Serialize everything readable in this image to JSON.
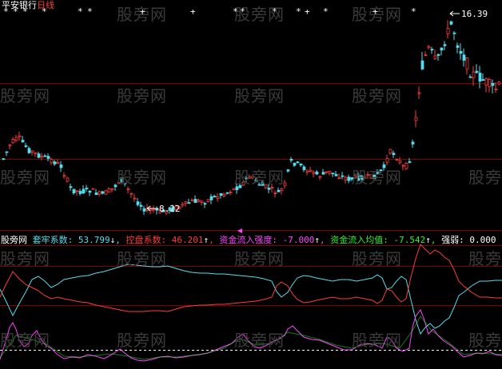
{
  "header": {
    "stock_name": "平安银行",
    "period": "日线"
  },
  "indicator": {
    "name": "股旁网",
    "items": [
      {
        "label": "套牢系数:",
        "value": "53.799",
        "arrow": "↓",
        "color": "#55ddee"
      },
      {
        "label": "控盘系数:",
        "value": "46.201",
        "arrow": "↑",
        "color": "#ff3b3b"
      },
      {
        "label": "资金流入强度:",
        "value": "-7.000",
        "arrow": "↑",
        "color": "#ff44ff"
      },
      {
        "label": "资金流入均值:",
        "value": "-7.542",
        "arrow": "↑",
        "color": "#33ee33"
      },
      {
        "label": "强弱:",
        "value": "0.000",
        "arrow": "",
        "color": "#ffffff"
      }
    ]
  },
  "price_labels": {
    "high": "16.39",
    "low": "8.22"
  },
  "watermark": "股旁网",
  "colors": {
    "up": "#ff3b3b",
    "down": "#55ddee",
    "gridline": "#800000",
    "background": "#000000"
  },
  "signal_marks": {
    "star": "*",
    "plus": "+"
  }
}
